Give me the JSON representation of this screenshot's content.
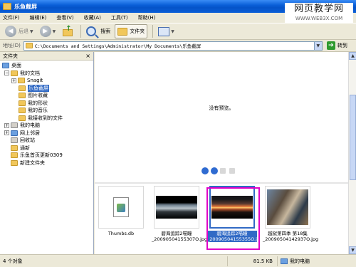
{
  "window": {
    "title": "乐鱼截屏"
  },
  "watermark": {
    "line1": "网页教学网",
    "line2": "WWW.WEB3X.COM"
  },
  "menu": {
    "items": [
      "文件(F)",
      "编辑(E)",
      "查看(V)",
      "收藏(A)",
      "工具(T)",
      "帮助(H)"
    ]
  },
  "toolbar": {
    "back_label": "后退",
    "search_label": "搜索",
    "folders_label": "文件夹"
  },
  "address": {
    "label": "地址(D)",
    "value": "C:\\Documents and Settings\\Administrator\\My Documents\\乐鱼截屏",
    "go_label": "转到"
  },
  "folder_pane": {
    "title": "文件夹",
    "close": "×"
  },
  "tree": [
    {
      "label": "桌面",
      "expander": "",
      "icon": "desktop-icon"
    },
    {
      "label": "我的文档",
      "expander": "−",
      "icon": "folder-icon"
    },
    {
      "label": "Snagit",
      "expander": "+",
      "icon": "folder-icon"
    },
    {
      "label": "乐鱼截屏",
      "expander": "",
      "icon": "folder-icon",
      "selected": true
    },
    {
      "label": "图片收藏",
      "expander": "",
      "icon": "folder-icon"
    },
    {
      "label": "我的形状",
      "expander": "",
      "icon": "folder-icon"
    },
    {
      "label": "我的音乐",
      "expander": "",
      "icon": "folder-icon"
    },
    {
      "label": "我接收到的文件",
      "expander": "",
      "icon": "folder-icon"
    },
    {
      "label": "我的电脑",
      "expander": "+",
      "icon": "computer-icon"
    },
    {
      "label": "网上邻居",
      "expander": "+",
      "icon": "network-icon"
    },
    {
      "label": "回收站",
      "expander": "",
      "icon": "recycle-bin-icon"
    },
    {
      "label": "通新",
      "expander": "",
      "icon": "folder-icon"
    },
    {
      "label": "乐鱼首页更新0309",
      "expander": "",
      "icon": "folder-icon"
    },
    {
      "label": "新建文件夹",
      "expander": "",
      "icon": "folder-icon"
    }
  ],
  "preview": {
    "message": "没有预览。"
  },
  "thumbnails": [
    {
      "name_line1": "Thumbs.db",
      "name_line2": "",
      "kind": "doc"
    },
    {
      "name_line1": "碧海追踪2喵瞳",
      "name_line2": "_20090504155307O.jpg",
      "kind": "img1"
    },
    {
      "name_line1": "碧海追踪2喵瞳",
      "name_line2": "_20090504155355O.jpg",
      "kind": "img2",
      "selected": true
    },
    {
      "name_line1": "越狱第四季 第18集",
      "name_line2": "_20090504142937O.jpg",
      "kind": "img3"
    }
  ],
  "status": {
    "objects": "4 个对象",
    "size": "81.5 KB",
    "location": "我的电脑"
  },
  "colors": {
    "titlebar": "#0a5fd8",
    "selection": "#316ac5",
    "highlight_rect": "#e000c8"
  }
}
